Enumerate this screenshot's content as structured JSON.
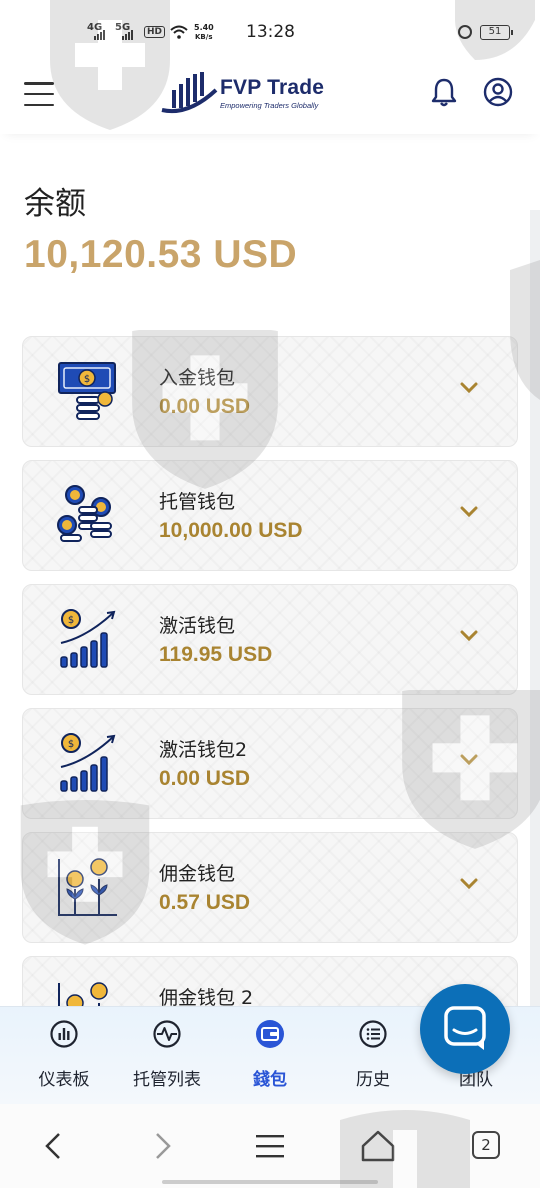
{
  "status_bar": {
    "time": "13:28",
    "network_1": "4G",
    "network_2": "5G",
    "hd_label": "HD",
    "speed": "5.40",
    "speed_unit": "KB/s",
    "battery": "51"
  },
  "header": {
    "logo_title": "FVP Trade",
    "logo_subtitle": "Empowering Traders Globally"
  },
  "balance": {
    "label": "余额",
    "value": "10,120.53 USD"
  },
  "wallets": [
    {
      "name": "入金钱包",
      "amount": "0.00 USD",
      "icon": "cash-icon"
    },
    {
      "name": "托管钱包",
      "amount": "10,000.00 USD",
      "icon": "coin-stack-icon"
    },
    {
      "name": "激活钱包",
      "amount": "119.95 USD",
      "icon": "growth-chart-icon"
    },
    {
      "name": "激活钱包2",
      "amount": "0.00 USD",
      "icon": "growth-chart-icon"
    },
    {
      "name": "佣金钱包",
      "amount": "0.57 USD",
      "icon": "coin-plant-icon"
    },
    {
      "name": "佣金钱包 2",
      "amount": "",
      "icon": "coin-plant-icon"
    }
  ],
  "bottom_nav": [
    {
      "label": "仪表板",
      "icon": "dashboard-icon"
    },
    {
      "label": "托管列表",
      "icon": "pulse-icon"
    },
    {
      "label": "錢包",
      "icon": "wallet-icon",
      "active": true
    },
    {
      "label": "历史",
      "icon": "list-icon"
    },
    {
      "label": "团队",
      "icon": "team-icon"
    }
  ],
  "browser": {
    "tab_count": "2"
  },
  "colors": {
    "accent_gold": "#c9a46a",
    "amount_gold": "#a98431",
    "nav_active": "#2a55d6",
    "chat_fab": "#0c6fb8",
    "icon_blue": "#1f4bb5"
  }
}
